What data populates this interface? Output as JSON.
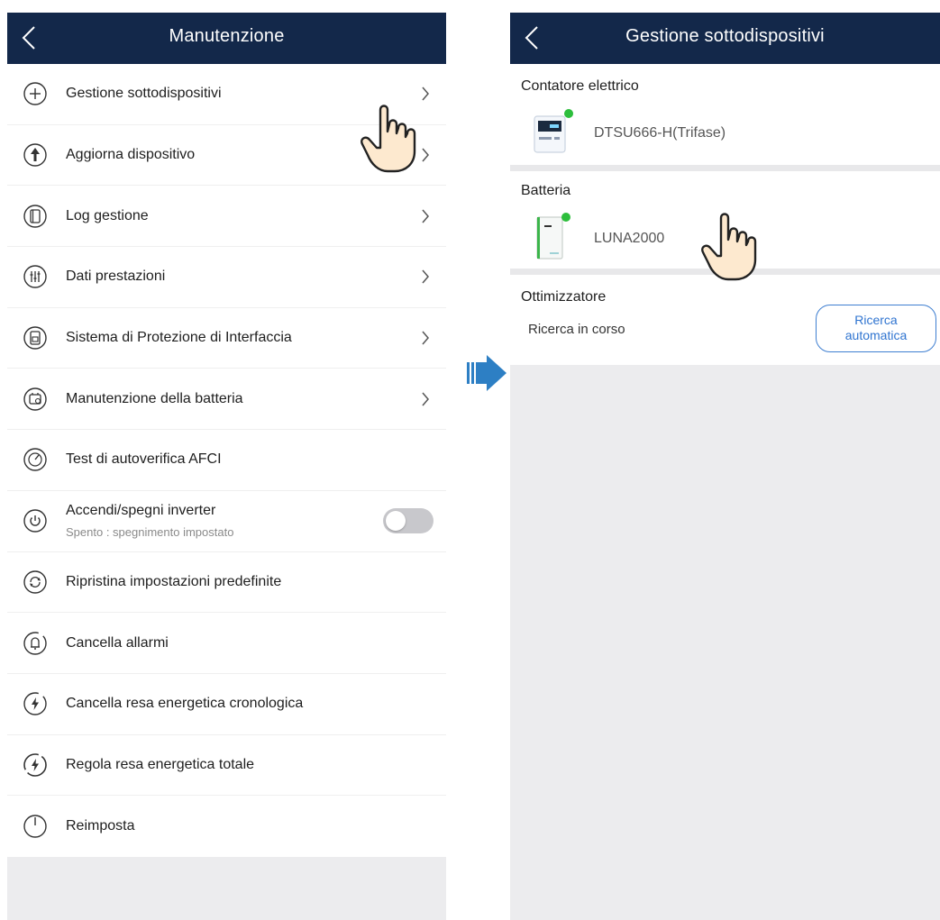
{
  "left": {
    "title": "Manutenzione",
    "items": [
      {
        "label": "Gestione sottodispositivi",
        "icon": "plus-circle-icon",
        "chevron": true
      },
      {
        "label": "Aggiorna dispositivo",
        "icon": "upload-arrow-icon",
        "chevron": true
      },
      {
        "label": "Log gestione",
        "icon": "log-icon",
        "chevron": true
      },
      {
        "label": "Dati prestazioni",
        "icon": "sliders-icon",
        "chevron": true
      },
      {
        "label": "Sistema di Protezione di Interfaccia",
        "icon": "protection-icon",
        "chevron": true
      },
      {
        "label": "Manutenzione della batteria",
        "icon": "battery-maintenance-icon",
        "chevron": true
      },
      {
        "label": "Test di autoverifica AFCI",
        "icon": "afci-test-icon",
        "chevron": false
      },
      {
        "label": "Accendi/spegni inverter",
        "sublabel": "Spento : spegnimento impostato",
        "icon": "power-icon",
        "toggle": false
      },
      {
        "label": "Ripristina impostazioni predefinite",
        "icon": "restore-icon",
        "chevron": false
      },
      {
        "label": "Cancella allarmi",
        "icon": "alarm-bell-icon",
        "chevron": false
      },
      {
        "label": "Cancella resa energetica cronologica",
        "icon": "energy-clear-icon",
        "chevron": false
      },
      {
        "label": "Regola resa energetica totale",
        "icon": "energy-adjust-icon",
        "chevron": false
      },
      {
        "label": "Reimposta",
        "icon": "reset-power-icon",
        "chevron": false
      }
    ]
  },
  "right": {
    "title": "Gestione sottodispositivi",
    "meter": {
      "section": "Contatore elettrico",
      "device": "DTSU666-H(Trifase)",
      "status_color": "#2dbe3c"
    },
    "battery": {
      "section": "Batteria",
      "device": "LUNA2000",
      "status_color": "#2dbe3c"
    },
    "optimizer": {
      "section": "Ottimizzatore",
      "status": "Ricerca in corso",
      "button_line1": "Ricerca",
      "button_line2": "automatica"
    }
  },
  "colors": {
    "header": "#13284a",
    "accent": "#2f74d0",
    "arrow": "#2d7fc4"
  }
}
